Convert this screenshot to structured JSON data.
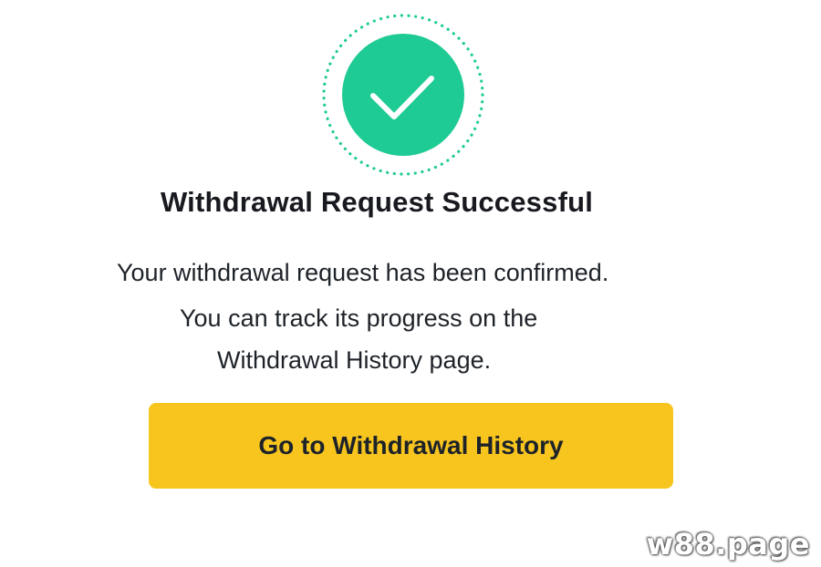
{
  "dialog": {
    "icon": "check-circle-icon",
    "title": "Withdrawal Request Successful",
    "message_lines": [
      "Your withdrawal request has been confirmed.",
      "You can track its progress on the",
      "Withdrawal History page."
    ],
    "button_label": "Go to Withdrawal History"
  },
  "watermark": "w88.page",
  "colors": {
    "success": "#1fcb94",
    "button": "#f8c51f",
    "text": "#1e2329"
  }
}
